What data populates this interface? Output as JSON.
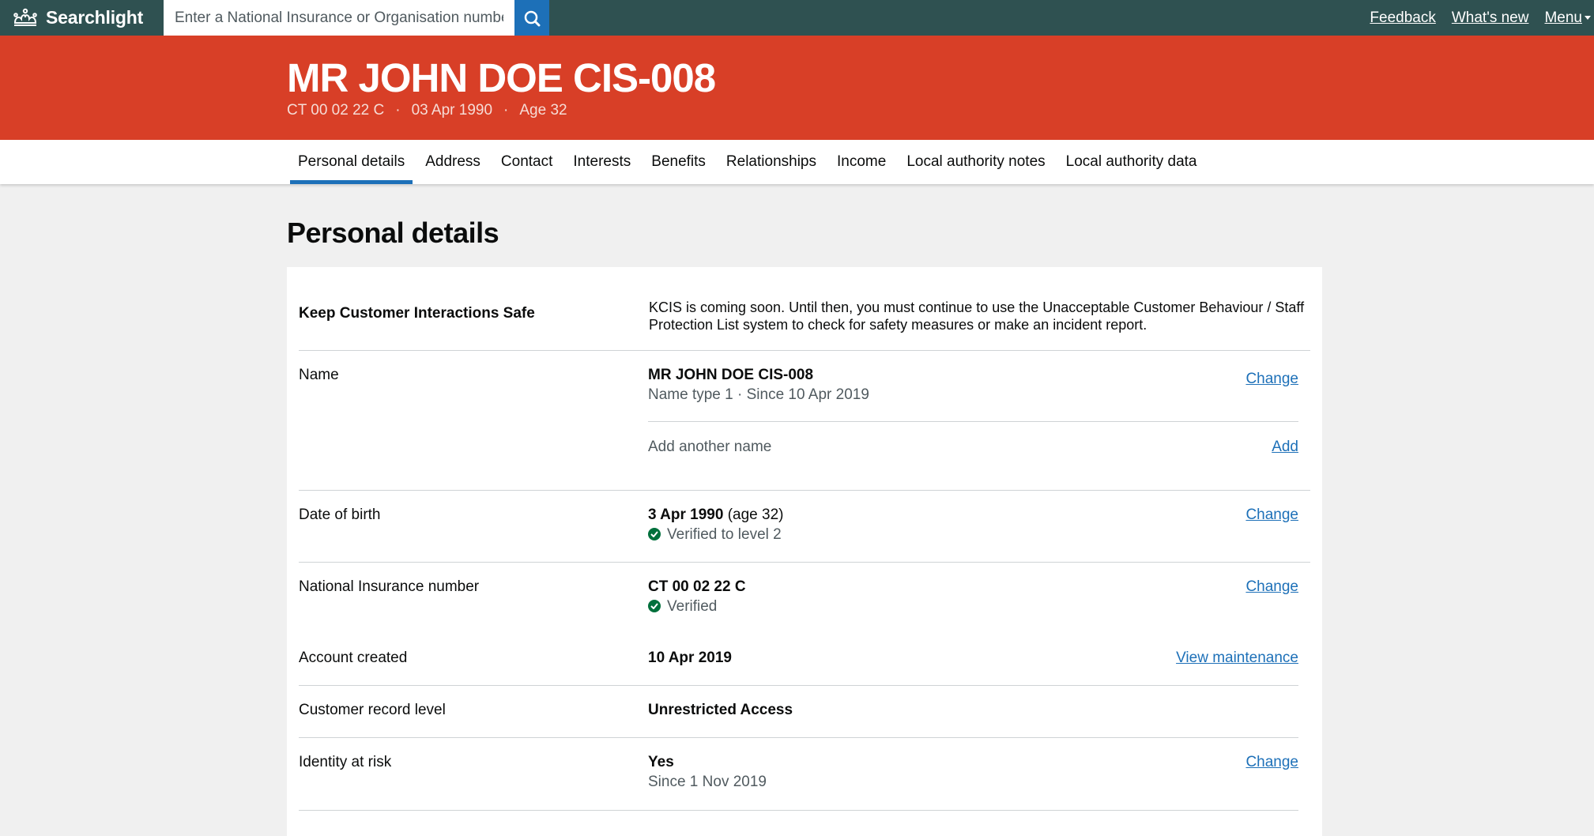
{
  "header": {
    "brand": "Searchlight",
    "search_placeholder": "Enter a National Insurance or Organisation number",
    "links": {
      "feedback": "Feedback",
      "whats_new": "What's new",
      "menu": "Menu"
    }
  },
  "banner": {
    "name": "MR JOHN DOE CIS-008",
    "nino": "CT 00 02 22 C",
    "dob": "03 Apr 1990",
    "age": "Age 32",
    "separator": "·"
  },
  "tabs": [
    "Personal details",
    "Address",
    "Contact",
    "Interests",
    "Benefits",
    "Relationships",
    "Income",
    "Local authority notes",
    "Local authority data"
  ],
  "page_title": "Personal details",
  "details": {
    "kcis": {
      "label": "Keep Customer Interactions Safe",
      "text": "KCIS is coming soon. Until then, you must continue to use the Unacceptable Customer Behaviour / Staff Protection List system to check for safety measures or make an incident report."
    },
    "name": {
      "label": "Name",
      "value": "MR JOHN DOE CIS-008",
      "sub": "Name type 1 · Since 10 Apr 2019",
      "action": "Change",
      "add_text": "Add another name",
      "add_action": "Add"
    },
    "dob": {
      "label": "Date of birth",
      "value": "3 Apr 1990",
      "value_suffix": "(age 32)",
      "status": "Verified to level 2",
      "action": "Change"
    },
    "nino": {
      "label": "National Insurance number",
      "value": "CT 00 02 22 C",
      "status": "Verified",
      "action": "Change"
    },
    "account_created": {
      "label": "Account created",
      "value": "10 Apr 2019",
      "action": "View maintenance"
    },
    "record_level": {
      "label": "Customer record level",
      "value": "Unrestricted Access"
    },
    "identity_risk": {
      "label": "Identity at risk",
      "value": "Yes",
      "sub": "Since 1 Nov 2019",
      "action": "Change"
    }
  },
  "colors": {
    "topbar": "#2f5151",
    "banner": "#d83f27",
    "link": "#1d70b8",
    "verified": "#00703c"
  }
}
